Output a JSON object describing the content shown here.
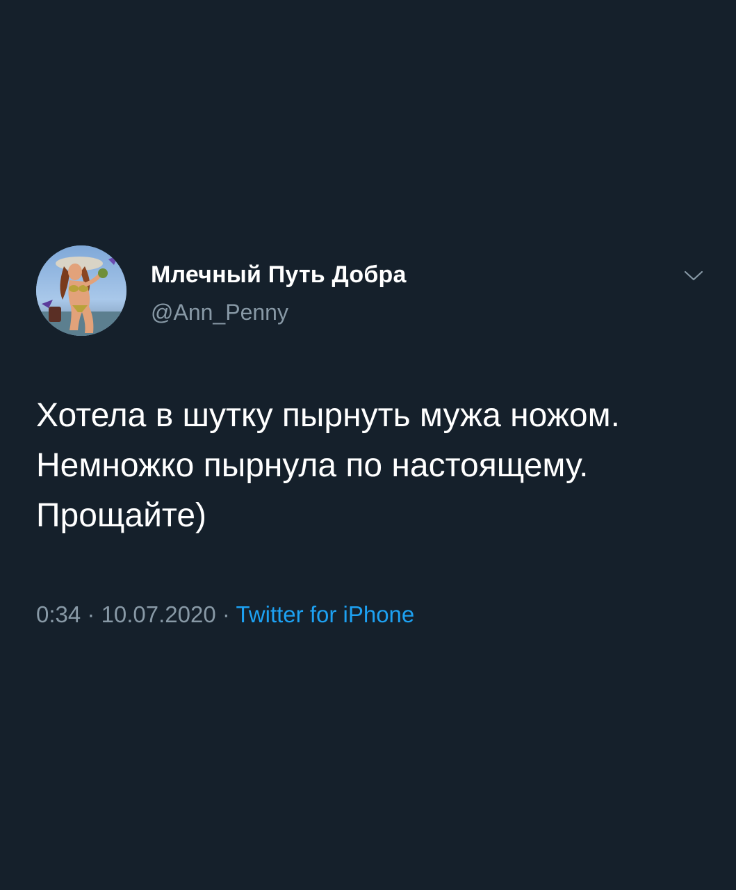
{
  "tweet": {
    "author": {
      "display_name": "Млечный Путь Добра",
      "handle": "@Ann_Penny",
      "avatar_icon": "avatar-illustration"
    },
    "menu_icon": "chevron-down-icon",
    "text_lines": [
      "Хотела в шутку пырнуть мужа ножом.",
      "Немножко пырнула по настоящему.",
      "Прощайте)"
    ],
    "meta": {
      "time": "0:34",
      "separator": " · ",
      "date": "10.07.2020",
      "source": "Twitter for iPhone"
    }
  },
  "colors": {
    "background": "#15202b",
    "primary_text": "#ffffff",
    "secondary_text": "#8899a6",
    "link": "#1da1f2"
  }
}
